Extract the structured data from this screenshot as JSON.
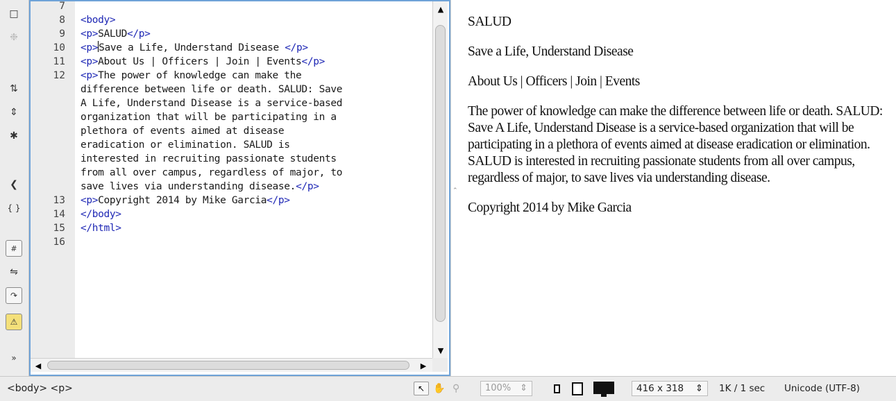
{
  "toolbar": {
    "icons": [
      "new-document-icon",
      "live-code-icon",
      "collapse-full-tag-icon",
      "collapse-selection-icon",
      "expand-all-icon",
      "select-parent-tag-icon",
      "balance-braces-icon",
      "line-numbers-icon",
      "highlight-invalid-code-icon",
      "word-wrap-icon",
      "syntax-error-alerts-icon",
      "more-icon"
    ]
  },
  "editor": {
    "lines": [
      {
        "num": "7",
        "code": [
          {
            "t": "",
            "tag": false
          }
        ]
      },
      {
        "num": "8",
        "code": [
          {
            "t": "<body>",
            "tag": true
          }
        ]
      },
      {
        "num": "9",
        "code": [
          {
            "t": "<p>",
            "tag": true
          },
          {
            "t": "SALUD",
            "tag": false
          },
          {
            "t": "</p>",
            "tag": true
          }
        ]
      },
      {
        "num": "10",
        "code": [
          {
            "t": "<p>",
            "tag": true
          },
          {
            "t": "Save a Life, Understand Disease ",
            "tag": false,
            "cursor_before": true
          },
          {
            "t": "</p>",
            "tag": true
          }
        ]
      },
      {
        "num": "11",
        "code": [
          {
            "t": "<p>",
            "tag": true
          },
          {
            "t": "About Us | Officers | Join | Events",
            "tag": false
          },
          {
            "t": "</p>",
            "tag": true
          }
        ]
      },
      {
        "num": "12",
        "code": [
          {
            "t": "<p>",
            "tag": true
          },
          {
            "t": "The power of knowledge can make the",
            "tag": false
          }
        ]
      },
      {
        "num": "",
        "code": [
          {
            "t": "difference between life or death. SALUD: Save",
            "tag": false
          }
        ]
      },
      {
        "num": "",
        "code": [
          {
            "t": "A Life, Understand Disease is a service-based",
            "tag": false
          }
        ]
      },
      {
        "num": "",
        "code": [
          {
            "t": "organization that will be participating in a",
            "tag": false
          }
        ]
      },
      {
        "num": "",
        "code": [
          {
            "t": "plethora of events aimed at disease",
            "tag": false
          }
        ]
      },
      {
        "num": "",
        "code": [
          {
            "t": "eradication or elimination. SALUD is",
            "tag": false
          }
        ]
      },
      {
        "num": "",
        "code": [
          {
            "t": "interested in recruiting passionate students",
            "tag": false
          }
        ]
      },
      {
        "num": "",
        "code": [
          {
            "t": "from all over campus, regardless of major, to",
            "tag": false
          }
        ]
      },
      {
        "num": "",
        "code": [
          {
            "t": "save lives via understanding disease.",
            "tag": false
          },
          {
            "t": "</p>",
            "tag": true
          }
        ]
      },
      {
        "num": "13",
        "code": [
          {
            "t": "<p>",
            "tag": true
          },
          {
            "t": "Copyright 2014 by Mike Garcia",
            "tag": false
          },
          {
            "t": "</p>",
            "tag": true
          }
        ]
      },
      {
        "num": "14",
        "code": [
          {
            "t": "</body>",
            "tag": true
          }
        ]
      },
      {
        "num": "15",
        "code": [
          {
            "t": "</html>",
            "tag": true
          }
        ]
      },
      {
        "num": "16",
        "code": [
          {
            "t": "",
            "tag": false
          }
        ]
      }
    ]
  },
  "design": {
    "paragraphs": [
      "SALUD",
      "Save a Life, Understand Disease",
      "About Us | Officers | Join | Events",
      "The power of knowledge can make the difference between life or death. SALUD: Save A Life, Understand Disease is a service-based organization that will be participating in a plethora of events aimed at disease eradication or elimination. SALUD is interested in recruiting passionate students from all over campus, regardless of major, to save lives via understanding disease.",
      "Copyright 2014 by Mike Garcia"
    ]
  },
  "status": {
    "tag_selector": "<body> <p>",
    "zoom": "100%",
    "window_size": "416 x 318",
    "download": "1K / 1 sec",
    "encoding": "Unicode (UTF-8)"
  }
}
